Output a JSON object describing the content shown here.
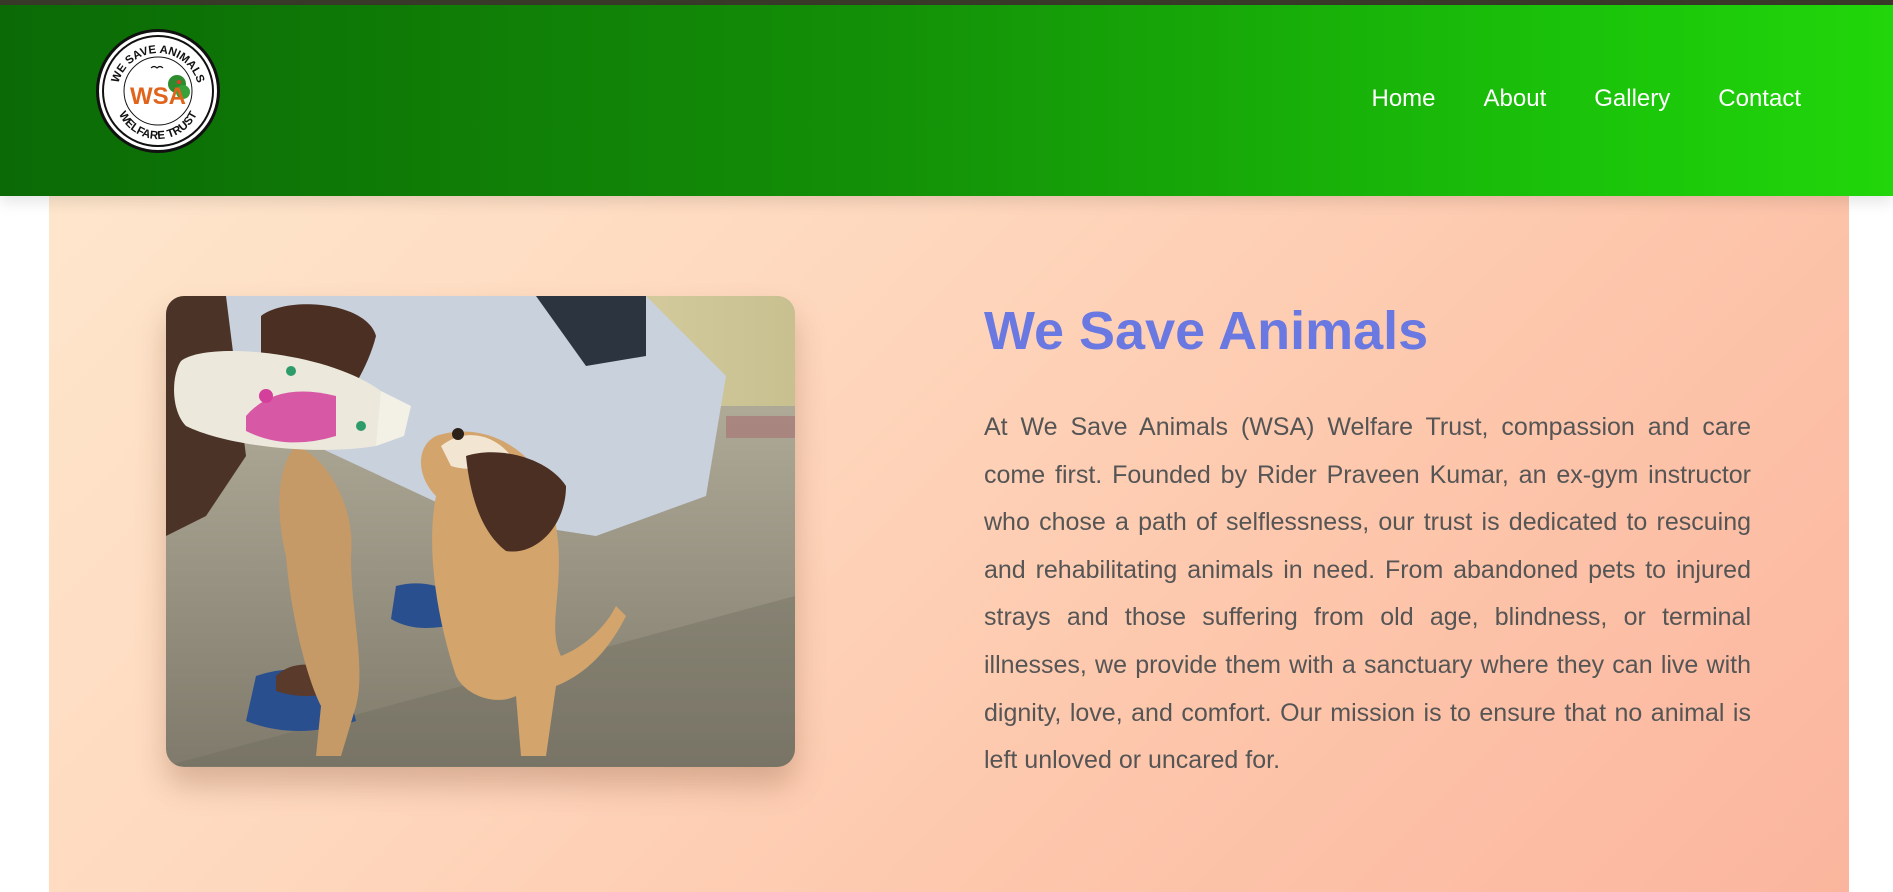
{
  "brand": {
    "logo_top_text": "WE SAVE ANIMALS",
    "logo_initials": "WSA",
    "logo_bottom_text": "WELFARE TRUST"
  },
  "nav": {
    "items": [
      {
        "label": "Home"
      },
      {
        "label": "About"
      },
      {
        "label": "Gallery"
      },
      {
        "label": "Contact"
      }
    ]
  },
  "hero": {
    "title": "We Save Animals",
    "description": "At We Save Animals (WSA) Welfare Trust, compassion and care come first. Founded by Rider Praveen Kumar, an ex-gym instructor who chose a path of selflessness, our trust is dedicated to rescuing and rehabilitating animals in need. From abandoned pets to injured strays and those suffering from old age, blindness, or terminal illnesses, we provide them with a sanctuary where they can live with dignity, love, and comfort. Our mission is to ensure that no animal is left unloved or uncared for."
  },
  "colors": {
    "header_start": "#0b6a06",
    "header_end": "#21d60a",
    "title": "#6a78e2",
    "body_text": "#555555",
    "hero_bg_start": "#fee6cc",
    "hero_bg_end": "#fbb59e"
  },
  "icons": {
    "logo": "wsa-logo-icon"
  }
}
